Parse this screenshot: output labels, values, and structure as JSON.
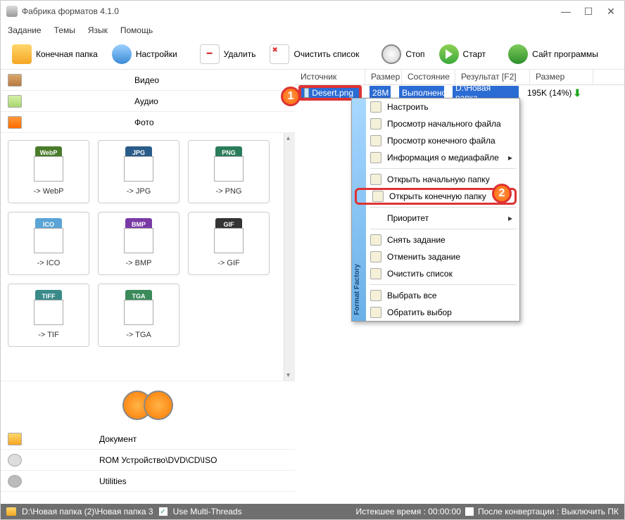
{
  "window": {
    "title": "Фабрика форматов 4.1.0"
  },
  "menu": {
    "task": "Задание",
    "themes": "Темы",
    "lang": "Язык",
    "help": "Помощь"
  },
  "toolbar": {
    "dest": "Конечная папка",
    "settings": "Настройки",
    "delete": "Удалить",
    "clear": "Очистить список",
    "stop": "Стоп",
    "start": "Старт",
    "site": "Сайт программы"
  },
  "cats": {
    "video": "Видео",
    "audio": "Аудио",
    "photo": "Фото",
    "document": "Документ",
    "rom": "ROM Устройство\\DVD\\CD\\ISO",
    "util": "Utilities"
  },
  "tiles": {
    "webp": "-> WebP",
    "jpg": "-> JPG",
    "png": "-> PNG",
    "ico": "-> ICO",
    "bmp": "-> BMP",
    "gif": "-> GIF",
    "tif": "-> TIF",
    "tga": "-> TGA"
  },
  "badges": {
    "webp": "WebP",
    "jpg": "JPG",
    "png": "PNG",
    "ico": "ICO",
    "bmp": "BMP",
    "gif": "GIF",
    "tiff": "TIFF",
    "tga": "TGA"
  },
  "columns": {
    "source": "Источник",
    "size": "Размер",
    "state": "Состояние",
    "result": "Результат [F2]",
    "size2": "Размер"
  },
  "row": {
    "file": "Desert.png",
    "size": "28M",
    "state": "Выполнено",
    "result": "D:\\Новая папка...",
    "out": "195K  (14%)"
  },
  "ctx": {
    "strip": "Format Factory",
    "configure": "Настроить",
    "view_src": "Просмотр начального файла",
    "view_dst": "Просмотр конечного файла",
    "mediainfo": "Информация о медиафайле",
    "open_src_folder": "Открыть начальную папку",
    "open_dst_folder": "Открыть конечную папку",
    "priority": "Приоритет",
    "remove": "Снять задание",
    "cancel": "Отменить задание",
    "clear": "Очистить список",
    "select_all": "Выбрать все",
    "invert": "Обратить выбор"
  },
  "markers": {
    "m1": "1",
    "m2": "2"
  },
  "status": {
    "path": "D:\\Новая папка (2)\\Новая папка 3",
    "threads": "Use Multi-Threads",
    "elapsed": "Истекшее время : 00:00:00",
    "after": "После конвертации : Выключить ПК"
  }
}
